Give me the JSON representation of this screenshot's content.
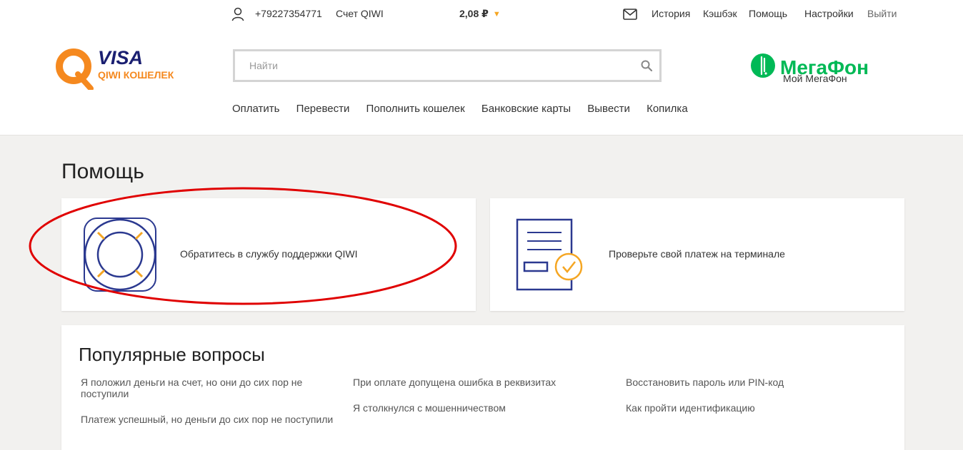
{
  "topbar": {
    "phone": "+79227354771",
    "account_label": "Счет QIWI",
    "balance": "2,08 ₽",
    "links": [
      "История",
      "Кэшбэк",
      "Помощь",
      "Настройки",
      "Выйти"
    ]
  },
  "logo": {
    "brand_top": "VISA",
    "brand_bottom": "QIWI КОШЕЛЕК"
  },
  "search": {
    "placeholder": "Найти"
  },
  "partner": {
    "name": "МегаФон",
    "sub": "Мой МегаФон"
  },
  "nav": [
    "Оплатить",
    "Перевести",
    "Пополнить кошелек",
    "Банковские карты",
    "Вывести",
    "Копилка"
  ],
  "page": {
    "title": "Помощь",
    "cards": [
      {
        "text": "Обратитесь в службу поддержки QIWI",
        "icon": "lifebuoy-icon"
      },
      {
        "text": "Проверьте свой платеж на терминале",
        "icon": "document-check-icon"
      }
    ]
  },
  "faq": {
    "title": "Популярные вопросы",
    "columns": [
      [
        "Я положил деньги на счет, но они до сих пор не поступили",
        "Платеж успешный, но деньги до сих пор не поступили"
      ],
      [
        "При оплате допущена ошибка в реквизитах",
        "Я столкнулся с мошенничеством"
      ],
      [
        "Восстановить пароль или PIN-код",
        "Как пройти идентификацию"
      ]
    ]
  },
  "colors": {
    "qiwi_orange": "#f5891f",
    "visa_blue": "#1a1f71",
    "megafon_green": "#00b956",
    "icon_navy": "#2b3990",
    "annotation_red": "#e00000",
    "content_bg": "#f2f1ef"
  }
}
